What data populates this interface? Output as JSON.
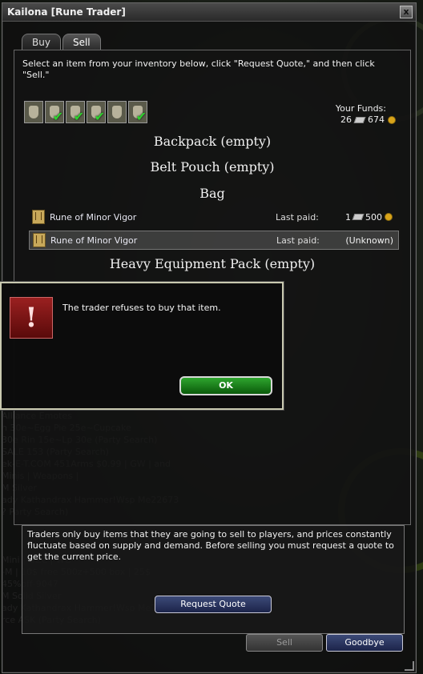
{
  "window": {
    "title": "Kailona [Rune Trader]",
    "close_glyph": "x"
  },
  "tabs": [
    {
      "label": "Buy"
    },
    {
      "label": "Sell"
    }
  ],
  "instructions": "Select an item from your inventory below, click \"Request Quote,\" and then click \"Sell.\"",
  "funds": {
    "label": "Your Funds:",
    "platinum": "26",
    "gold": "674"
  },
  "bags": [
    {
      "icon": "backpack-icon",
      "checked": false
    },
    {
      "icon": "bag-icon",
      "checked": true
    },
    {
      "icon": "bag-icon",
      "checked": true
    },
    {
      "icon": "bag-icon",
      "checked": true
    },
    {
      "icon": "bag-icon",
      "checked": false
    },
    {
      "icon": "bag-icon",
      "checked": true
    }
  ],
  "sections": {
    "backpack": "Backpack (empty)",
    "belt_pouch": "Belt Pouch (empty)",
    "bag": "Bag",
    "heavy_pack": "Heavy Equipment Pack (empty)"
  },
  "items": [
    {
      "name": "Rune of Minor Vigor",
      "last_paid_label": "Last paid:",
      "price_plat": "1",
      "price_gold": "500",
      "selected": false
    },
    {
      "name": "Rune of Minor Vigor",
      "last_paid_label": "Last paid:",
      "price_text": "(Unknown)",
      "selected": true
    }
  ],
  "dialog": {
    "icon": "exclamation-icon",
    "message": "The trader refuses to buy that item.",
    "ok_label": "OK"
  },
  "info": {
    "text": "Traders only buy items that they are going to sell to players, and prices constantly fluctuate based on supply and demand. Before selling you must request a quote to get the current price.",
    "quote_label": "Request Quote"
  },
  "buttons": {
    "sell_label": "Sell",
    "goodbye_label": "Goodbye"
  },
  "background_chat": [
    "Alliance   Emotes",
    "n 30e~Egg Pie 25e~Cupcake",
    "30e Rin 15e~Lp 30e (Party Search)",
    "SALE 153 (Party Search)",
    "ek-E-T.COM 451Arms $0.99 | GW | and",
    "Minis | Weapons |",
    "M Silver",
    "ady Kathandrax Hammer!Wsp Me22673",
    "? Party Search)",
    "",
    "",
    "",
    "Mini | GZC | WG",
    "-M | 10$ free 500z+500 box | 25$",
    "45%off-9047",
    "M Solid Silver",
    "ady Kathandrax Hammer!Wsp Me16202",
    "rce ASK (Party Search)"
  ],
  "colors": {
    "ok_green": "#2fa52f",
    "button_blue": "#2c3760",
    "alert_red": "#8a1a1a",
    "coin_gold": "#d9a41a"
  }
}
